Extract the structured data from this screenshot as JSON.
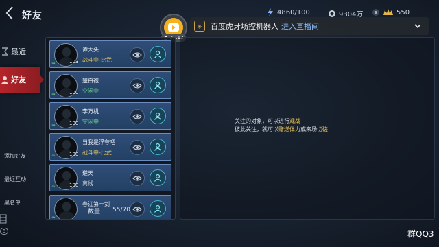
{
  "header": {
    "title": "好友",
    "stamina": "4860/100",
    "coins": "9304万",
    "gems": "550"
  },
  "stream": {
    "viewers": "2,113",
    "name": "百度虎牙场控机器人",
    "link": "进入直播间"
  },
  "nav": {
    "recent": "最近",
    "friends": "好友",
    "add_friend": "添加好友",
    "recent_interact": "最近互动",
    "blacklist": "黑名单",
    "badge": "8"
  },
  "friends": [
    {
      "name": "谭大头",
      "status": "战斗中-比武",
      "level": "103"
    },
    {
      "name": "楚白袍",
      "status": "空闲中",
      "level": "100"
    },
    {
      "name": "李万机",
      "status": "空闲中",
      "level": "100"
    },
    {
      "name": "当我是浮夸吧",
      "status": "战斗中-比武",
      "level": "100"
    },
    {
      "name": "逆天",
      "status": "离线",
      "level": "100"
    },
    {
      "name": "春江第一剑",
      "status": "",
      "level": ""
    }
  ],
  "count": {
    "label": "数量",
    "value": "55/70"
  },
  "info": {
    "line1_pre": "关注的对象，可以进行",
    "line1_hl": "观战",
    "line2_pre": "彼此关注，就可以",
    "line2_hl1": "赠送体力",
    "line2_mid": "或来场",
    "line2_hl2": "切磋"
  },
  "watermark": "群QQ3"
}
